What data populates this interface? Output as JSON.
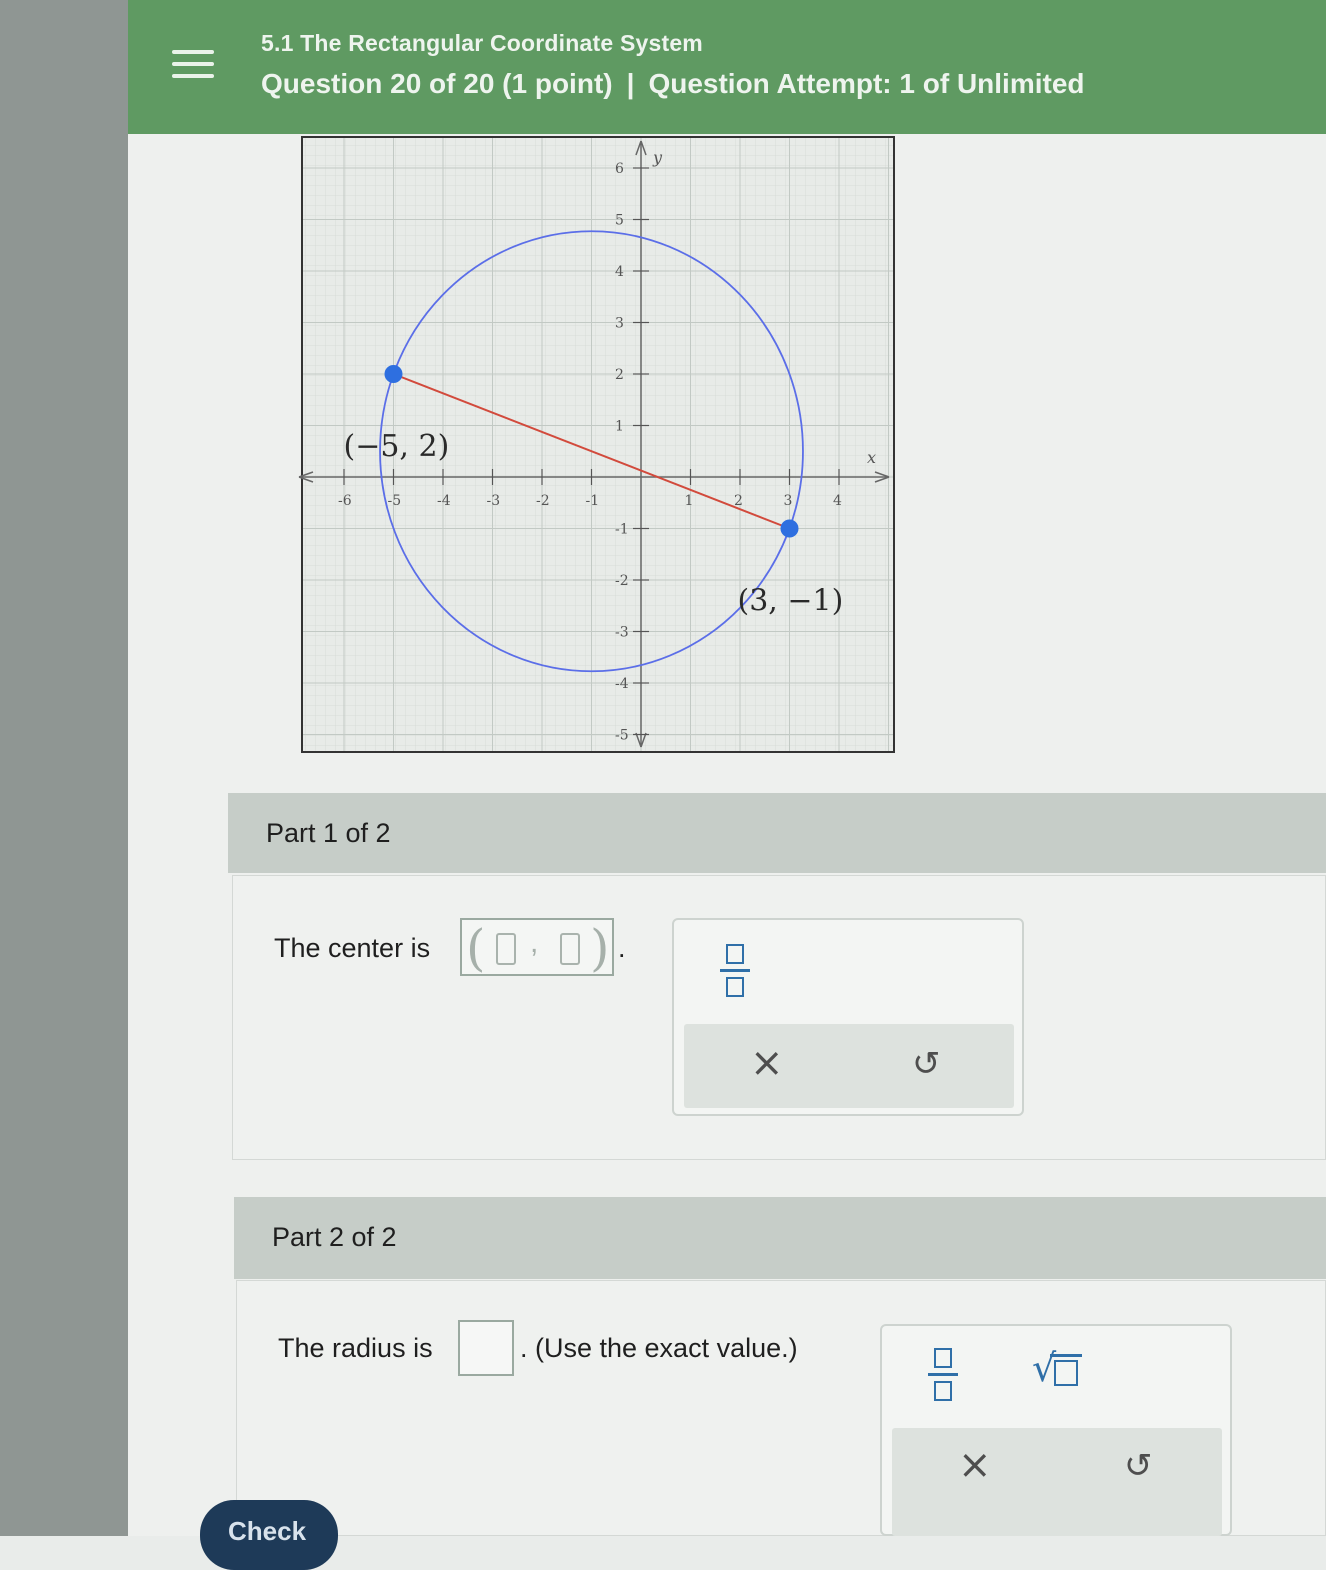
{
  "header": {
    "section_title": "5.1 The Rectangular Coordinate System",
    "question_label": "Question 20 of 20 (1 point)",
    "separator": "|",
    "attempt_label": "Question Attempt: 1 of Unlimited",
    "menu_icon": "hamburger-menu-icon",
    "bg_color": "#5f9a62"
  },
  "graph": {
    "x_axis_label": "x",
    "y_axis_label": "y",
    "x_ticks": [
      "-6",
      "-5",
      "-4",
      "-3",
      "-2",
      "-1",
      "1",
      "2",
      "3",
      "4"
    ],
    "y_ticks": [
      "6",
      "5",
      "4",
      "3",
      "2",
      "1",
      "-1",
      "-2",
      "-3",
      "-4",
      "-5"
    ],
    "x_range": [
      -6.5,
      5
    ],
    "y_range": [
      -5.5,
      6.5
    ],
    "point_a": {
      "label": "(−5, 2)",
      "x": -5,
      "y": 2
    },
    "point_b": {
      "label": "(3, −1)",
      "x": 3,
      "y": -1
    },
    "circle_color": "#5b6ee8",
    "segment_color": "#d24a3c",
    "point_color": "#2e6fe0"
  },
  "part1": {
    "label": "Part 1 of 2",
    "prompt": "The center is",
    "open_paren": "(",
    "comma": ",",
    "close_paren": ")",
    "period": ".",
    "tools": {
      "fraction": "fraction-icon",
      "clear": "×",
      "undo": "↺"
    }
  },
  "part2": {
    "label": "Part 2 of 2",
    "prompt": "The radius is",
    "suffix": ". (Use the exact value.)",
    "tools": {
      "fraction": "fraction-icon",
      "sqrt": "√",
      "clear": "×",
      "undo": "↺"
    }
  },
  "check_button": "Check"
}
